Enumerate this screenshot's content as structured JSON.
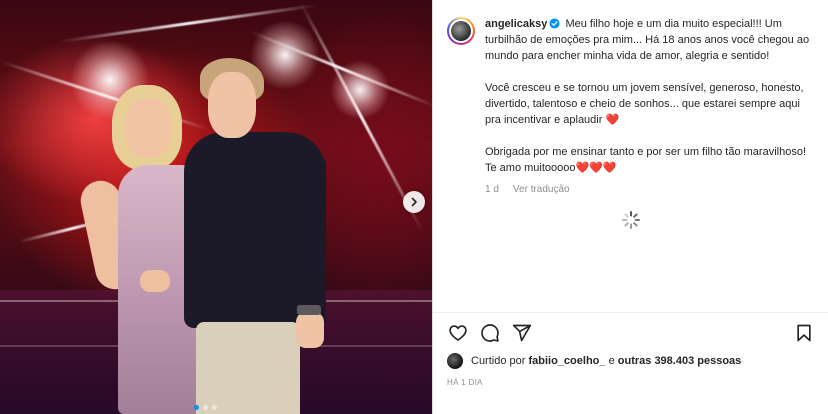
{
  "post": {
    "carousel": {
      "slide_count": 3,
      "active_slide": 1
    }
  },
  "author": {
    "username": "angelicaksy",
    "verified": true
  },
  "caption": {
    "paragraph_1": "Meu filho hoje e um dia muito especial!!! Um turbilhão de emoções pra mim... Há 18 anos anos você chegou ao mundo para encher minha vida de amor, alegria e sentido!",
    "paragraph_2": "Você cresceu e se tornou um jovem sensível, generoso, honesto, divertido, talentoso e cheio de sonhos... que estarei sempre aqui pra incentivar e aplaudir ❤️",
    "paragraph_3": "Obrigada por me ensinar tanto e por ser um filho tão maravilhoso! Te amo muitooooo❤️❤️❤️",
    "age": "1 d",
    "translate_label": "Ver tradução"
  },
  "likes": {
    "prefix": "Curtido por",
    "user": "fabiio_coelho_",
    "connector": "e",
    "others": "outras 398.403 pessoas"
  },
  "timestamp": "HÁ 1 DIA",
  "icons": {
    "like": "heart-icon",
    "comment": "comment-icon",
    "share": "share-icon",
    "save": "bookmark-icon",
    "next": "chevron-right-icon",
    "loading": "spinner-icon",
    "verified": "verified-badge-icon"
  },
  "colors": {
    "verified_blue": "#0095f6",
    "text": "#262626",
    "muted": "#8e8e8e"
  }
}
